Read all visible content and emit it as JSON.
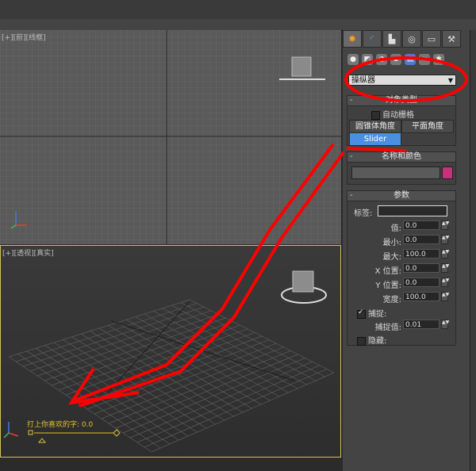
{
  "viewport_top": {
    "label_bracket": "[+]",
    "label_view": "[前]",
    "label_shade": "[线框]"
  },
  "viewport_persp": {
    "label_bracket": "[+]",
    "label_view": "[透视]",
    "label_shade": "[真实]"
  },
  "hud": {
    "text": "打上你喜欢的字: 0.0"
  },
  "panel": {
    "tabs": [
      "create-tab",
      "modify-tab",
      "hierarchy-tab",
      "motion-tab",
      "display-tab",
      "utilities-tab"
    ],
    "dropdown_value": "操纵器",
    "object_type": {
      "title": "对象类型",
      "autogrid_label": "自动栅格",
      "buttons": [
        "圆锥体角度",
        "平面角度",
        "Slider"
      ]
    },
    "name_color": {
      "title": "名称和颜色",
      "name_value": "",
      "swatch_color": "#c8307a"
    },
    "params": {
      "title": "参数",
      "label_label": "标签:",
      "label_value": "",
      "rows": [
        {
          "label": "值:",
          "value": "0.0"
        },
        {
          "label": "最小:",
          "value": "0.0"
        },
        {
          "label": "最大:",
          "value": "100.0"
        },
        {
          "label": "X 位置:",
          "value": "0.0"
        },
        {
          "label": "Y 位置:",
          "value": "0.0"
        },
        {
          "label": "宽度:",
          "value": "100.0"
        }
      ],
      "snap_label": "捕捉:",
      "snap_value_label": "捕捉值:",
      "snap_value": "0.01",
      "hidden_label": "隐藏:"
    }
  },
  "colors": {
    "annotation": "#ff0000",
    "selected_button": "#4a8fe0",
    "viewport_border": "#d8c05a"
  }
}
